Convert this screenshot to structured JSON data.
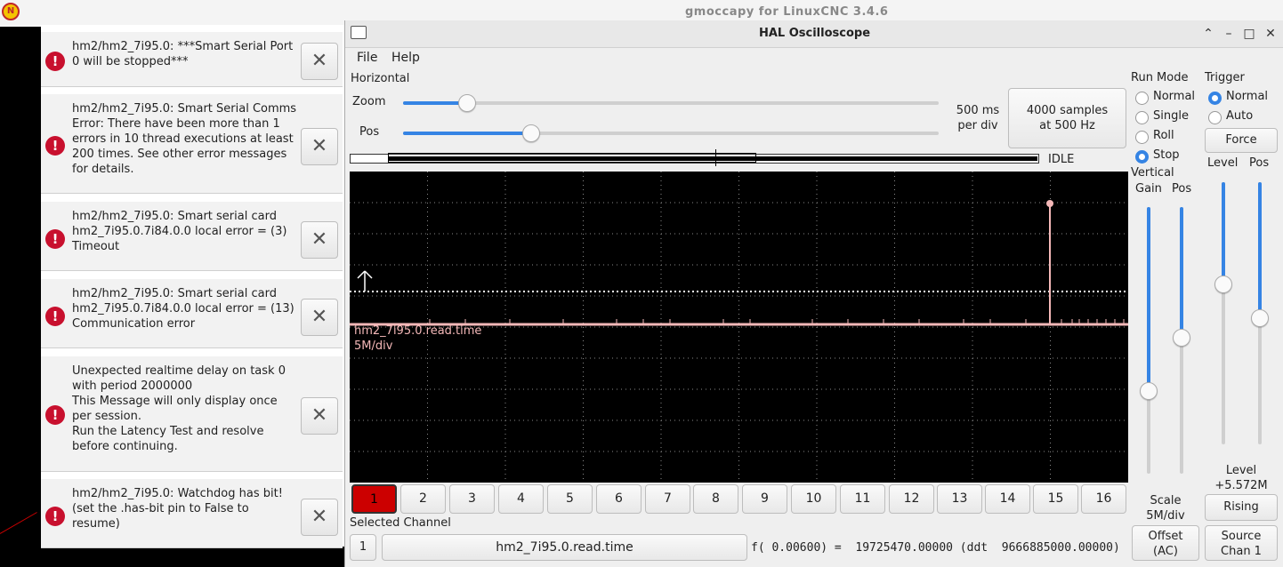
{
  "desktop": {
    "title": "gmoccapy for LinuxCNC  3.4.6",
    "app_icon": "linuxcnc-logo-icon"
  },
  "notifications": [
    {
      "icon": "error-icon",
      "text": "hm2/hm2_7i95.0: ***Smart Serial Port 0 will be stopped***"
    },
    {
      "icon": "error-icon",
      "text": "hm2/hm2_7i95.0: Smart Serial Comms Error: There have been more than 1 errors in 10 thread executions at least 200 times. See other error messages for details."
    },
    {
      "icon": "error-icon",
      "text": "hm2/hm2_7i95.0: Smart serial card hm2_7i95.0.7i84.0.0 local error = (3) Timeout"
    },
    {
      "icon": "error-icon",
      "text": "hm2/hm2_7i95.0: Smart serial card hm2_7i95.0.7i84.0.0 local error = (13) Communication error"
    },
    {
      "icon": "error-icon",
      "text": "Unexpected realtime delay on task 0 with period 2000000\nThis Message will only display once per session.\nRun the Latency Test and resolve before continuing."
    },
    {
      "icon": "error-icon",
      "text": "hm2/hm2_7i95.0: Watchdog has bit! (set the .has-bit pin to False to resume)"
    }
  ],
  "scope": {
    "title": "HAL Oscilloscope",
    "menu": [
      "File",
      "Help"
    ],
    "horizontal": {
      "label": "Horizontal",
      "zoom_label": "Zoom",
      "zoom_value": 0.12,
      "pos_label": "Pos",
      "pos_value": 0.24,
      "rate_text": "500 ms\nper div",
      "samples_button": "4000 samples\nat 500 Hz",
      "status": "IDLE"
    },
    "run_mode": {
      "label": "Run Mode",
      "options": [
        "Normal",
        "Single",
        "Roll",
        "Stop"
      ],
      "selected": "Stop"
    },
    "trigger": {
      "label": "Trigger",
      "options": [
        "Normal",
        "Auto"
      ],
      "selected": "Normal",
      "force": "Force",
      "level_label": "Level",
      "pos_label": "Pos",
      "level_value": 0.61,
      "pos_value": 0.48,
      "level_text": "Level\n+5.572M",
      "edge_button": "Rising",
      "source_button": "Source\nChan  1"
    },
    "vertical": {
      "label": "Vertical",
      "gain_label": "Gain",
      "pos_label": "Pos",
      "gain_value": 0.31,
      "pos_value": 0.51,
      "scale_text": "Scale\n5M/div",
      "offset_button": "Offset\n(AC)"
    },
    "plot": {
      "trace_name": "hm2_7i95.0.read.time",
      "trace_scale": "5M/div",
      "trace_color": "#f4b8b8"
    },
    "channels": [
      "1",
      "2",
      "3",
      "4",
      "5",
      "6",
      "7",
      "8",
      "9",
      "10",
      "11",
      "12",
      "13",
      "14",
      "15",
      "16"
    ],
    "selected_channel_index": 0,
    "selected_channel_label": "Selected Channel",
    "selected_channel_number": "1",
    "selected_channel_name": "hm2_7i95.0.read.time",
    "readout": "f( 0.00600) =  19725470.00000 (ddt  9666885000.00000)"
  }
}
